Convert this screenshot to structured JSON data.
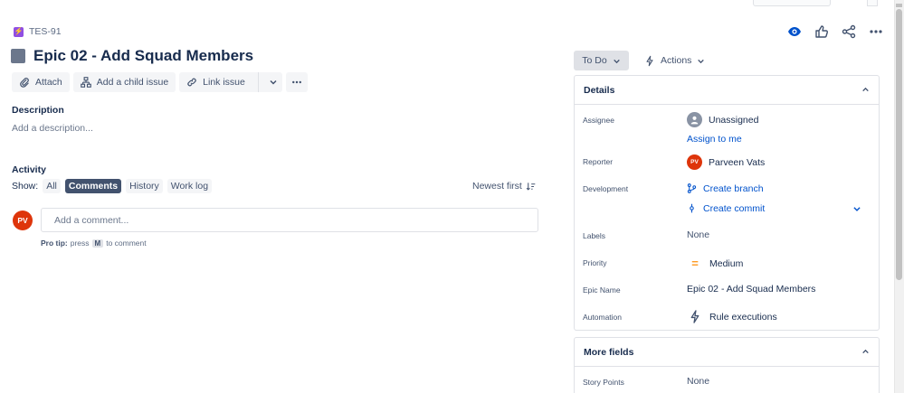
{
  "issue": {
    "key": "TES-91",
    "title": "Epic 02 - Add Squad Members"
  },
  "toolbar": {
    "attach": "Attach",
    "add_child": "Add a child issue",
    "link_issue": "Link issue"
  },
  "description": {
    "heading": "Description",
    "placeholder": "Add a description..."
  },
  "activity": {
    "heading": "Activity",
    "show_label": "Show:",
    "filters": [
      "All",
      "Comments",
      "History",
      "Work log"
    ],
    "selected": "Comments",
    "sort": "Newest first"
  },
  "comment": {
    "avatar_initials": "PV",
    "placeholder": "Add a comment...",
    "tip_bold": "Pro tip:",
    "tip_press": "press",
    "tip_key": "M",
    "tip_rest": "to comment"
  },
  "status": {
    "label": "To Do",
    "actions": "Actions"
  },
  "details": {
    "heading": "Details",
    "assignee_label": "Assignee",
    "assignee_value": "Unassigned",
    "assign_to_me": "Assign to me",
    "reporter_label": "Reporter",
    "reporter_initials": "PV",
    "reporter_value": "Parveen Vats",
    "development_label": "Development",
    "create_branch": "Create branch",
    "create_commit": "Create commit",
    "labels_label": "Labels",
    "labels_value": "None",
    "priority_label": "Priority",
    "priority_value": "Medium",
    "epic_name_label": "Epic Name",
    "epic_name_value": "Epic 02 - Add Squad Members",
    "automation_label": "Automation",
    "automation_value": "Rule executions"
  },
  "more_fields": {
    "heading": "More fields",
    "story_points_label": "Story Points",
    "story_points_value": "None"
  },
  "colors": {
    "accent": "#0052cc",
    "epic_purple": "#904ee2",
    "avatar_red": "#de350b",
    "priority_medium": "#ff991f"
  },
  "icons": [
    "epic-icon",
    "attach-icon",
    "child-issue-icon",
    "link-icon",
    "chevron-down-icon",
    "more-icon",
    "watch-icon",
    "like-icon",
    "share-icon",
    "lightning-icon",
    "branch-icon",
    "commit-icon",
    "priority-medium-icon",
    "sort-icon",
    "user-icon"
  ]
}
